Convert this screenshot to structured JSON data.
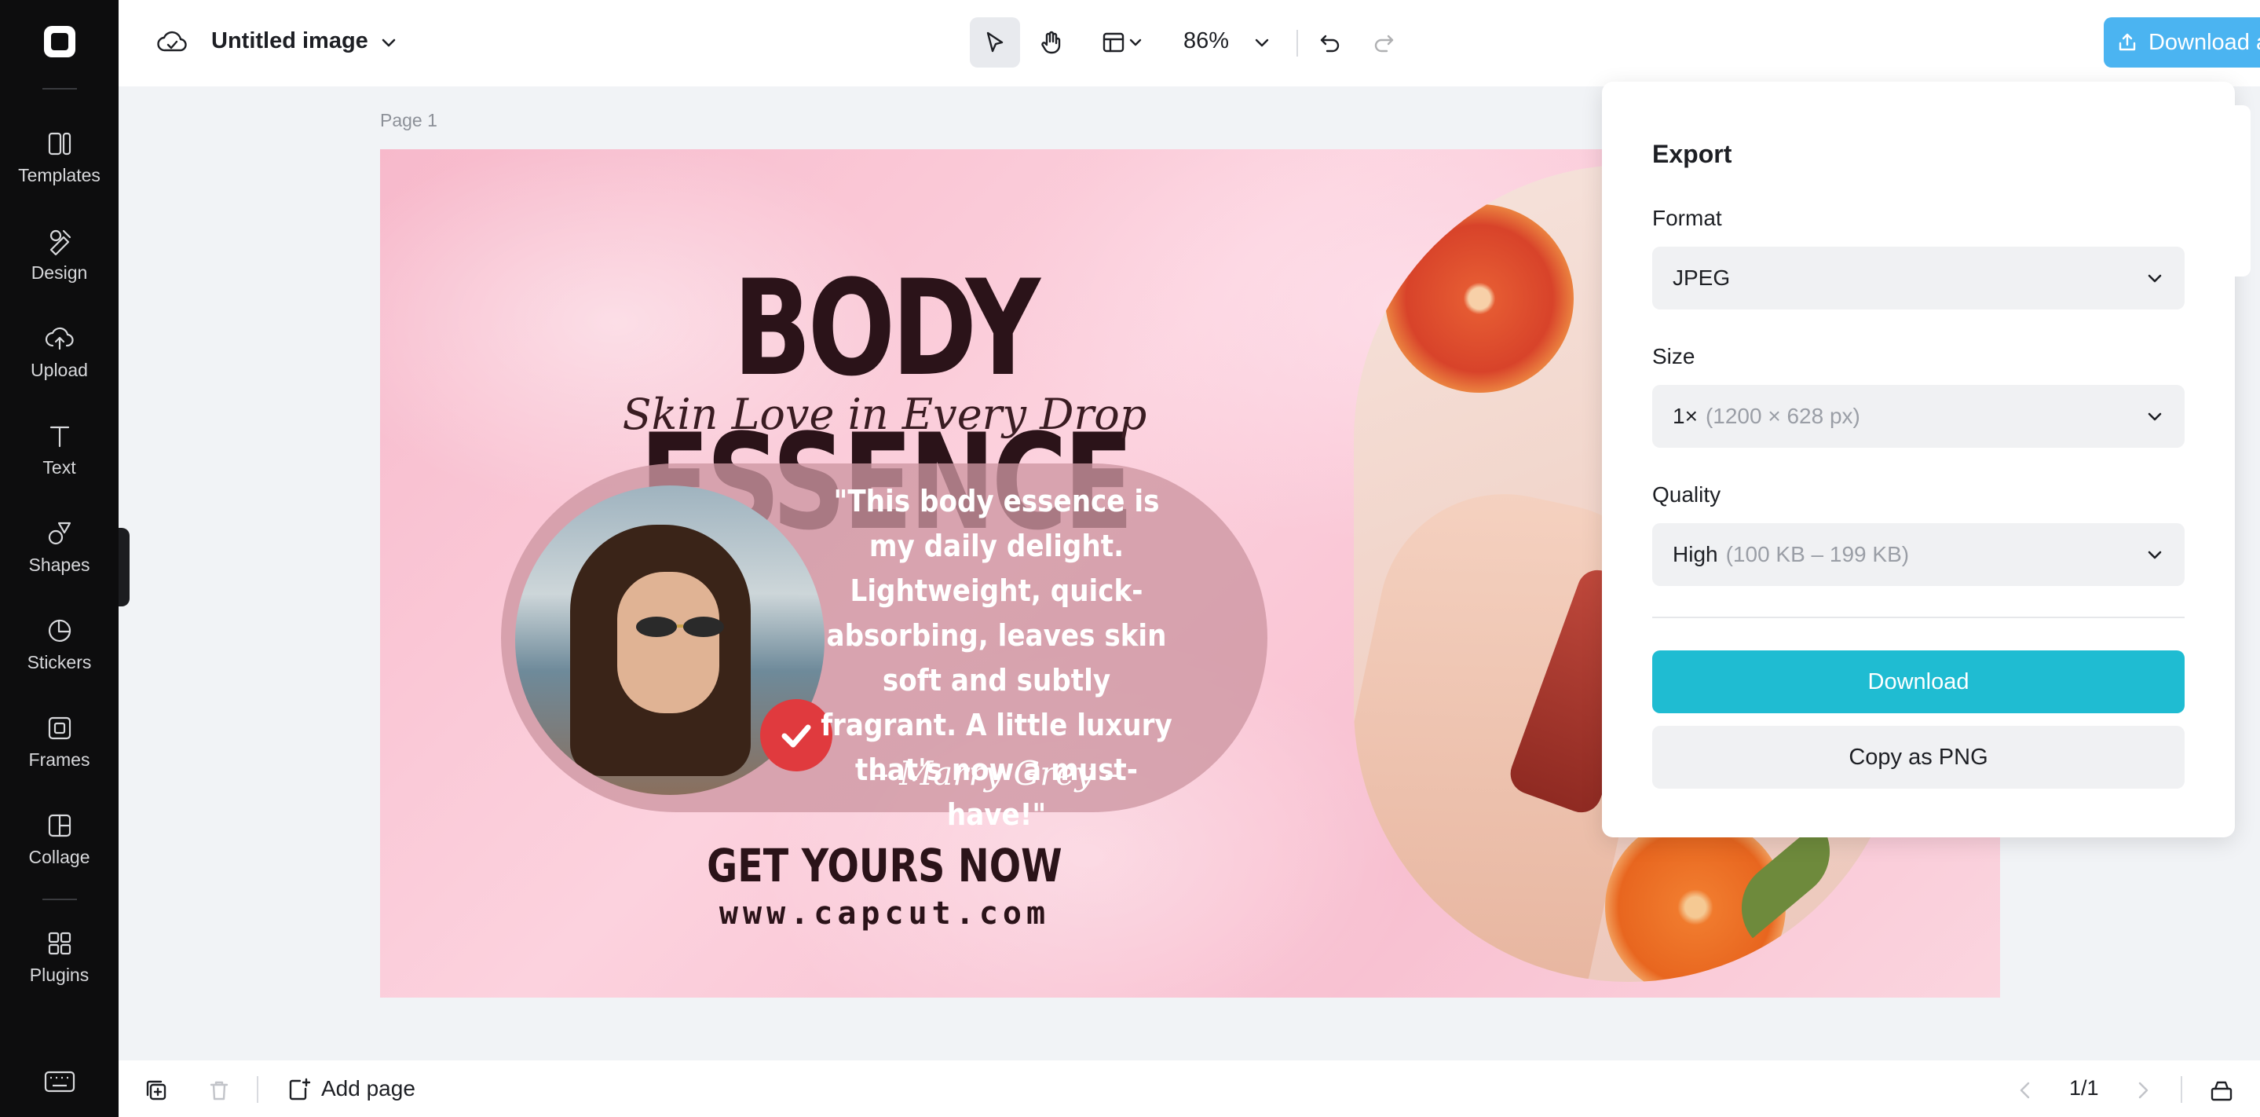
{
  "topbar": {
    "doc_title": "Untitled image",
    "zoom": "86%",
    "download_all": "Download all"
  },
  "sidebar": {
    "items": [
      {
        "label": "Templates",
        "icon": "templates-icon"
      },
      {
        "label": "Design",
        "icon": "design-icon"
      },
      {
        "label": "Upload",
        "icon": "upload-icon"
      },
      {
        "label": "Text",
        "icon": "text-icon"
      },
      {
        "label": "Shapes",
        "icon": "shapes-icon"
      },
      {
        "label": "Stickers",
        "icon": "stickers-icon"
      },
      {
        "label": "Frames",
        "icon": "frames-icon"
      },
      {
        "label": "Collage",
        "icon": "collage-icon"
      },
      {
        "label": "Plugins",
        "icon": "plugins-icon"
      }
    ]
  },
  "canvas": {
    "page_label": "Page 1",
    "headline": "BODY ESSENCE",
    "tagline": "Skin Love in Every Drop",
    "quote": "\"This body essence is my daily delight. Lightweight, quick-absorbing, leaves skin soft and subtly fragrant. A little luxury that's now a must-have!\"",
    "author": "– Marry Grey –",
    "cta": "GET YOURS NOW",
    "url": "www.capcut.com"
  },
  "export": {
    "title": "Export",
    "format_label": "Format",
    "format_value": "JPEG",
    "size_label": "Size",
    "size_value": "1×",
    "size_detail": "(1200 × 628 px)",
    "quality_label": "Quality",
    "quality_value": "High",
    "quality_detail": "(100 KB – 199 KB)",
    "download_label": "Download",
    "copy_label": "Copy as PNG"
  },
  "bottombar": {
    "add_page": "Add page",
    "page_count": "1/1"
  },
  "colors": {
    "download_all_bg": "#4bb4f1",
    "download_bg": "#1fbcd2",
    "sidebar_bg": "#0d0d0e",
    "badge_red": "#e03a3e"
  }
}
